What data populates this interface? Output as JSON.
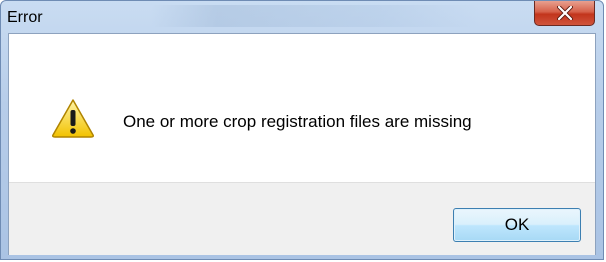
{
  "window": {
    "title": "Error"
  },
  "dialog": {
    "message": "One or more crop registration files are missing",
    "icon": "warning-icon"
  },
  "buttons": {
    "ok_label": "OK",
    "close_icon": "close-icon"
  }
}
